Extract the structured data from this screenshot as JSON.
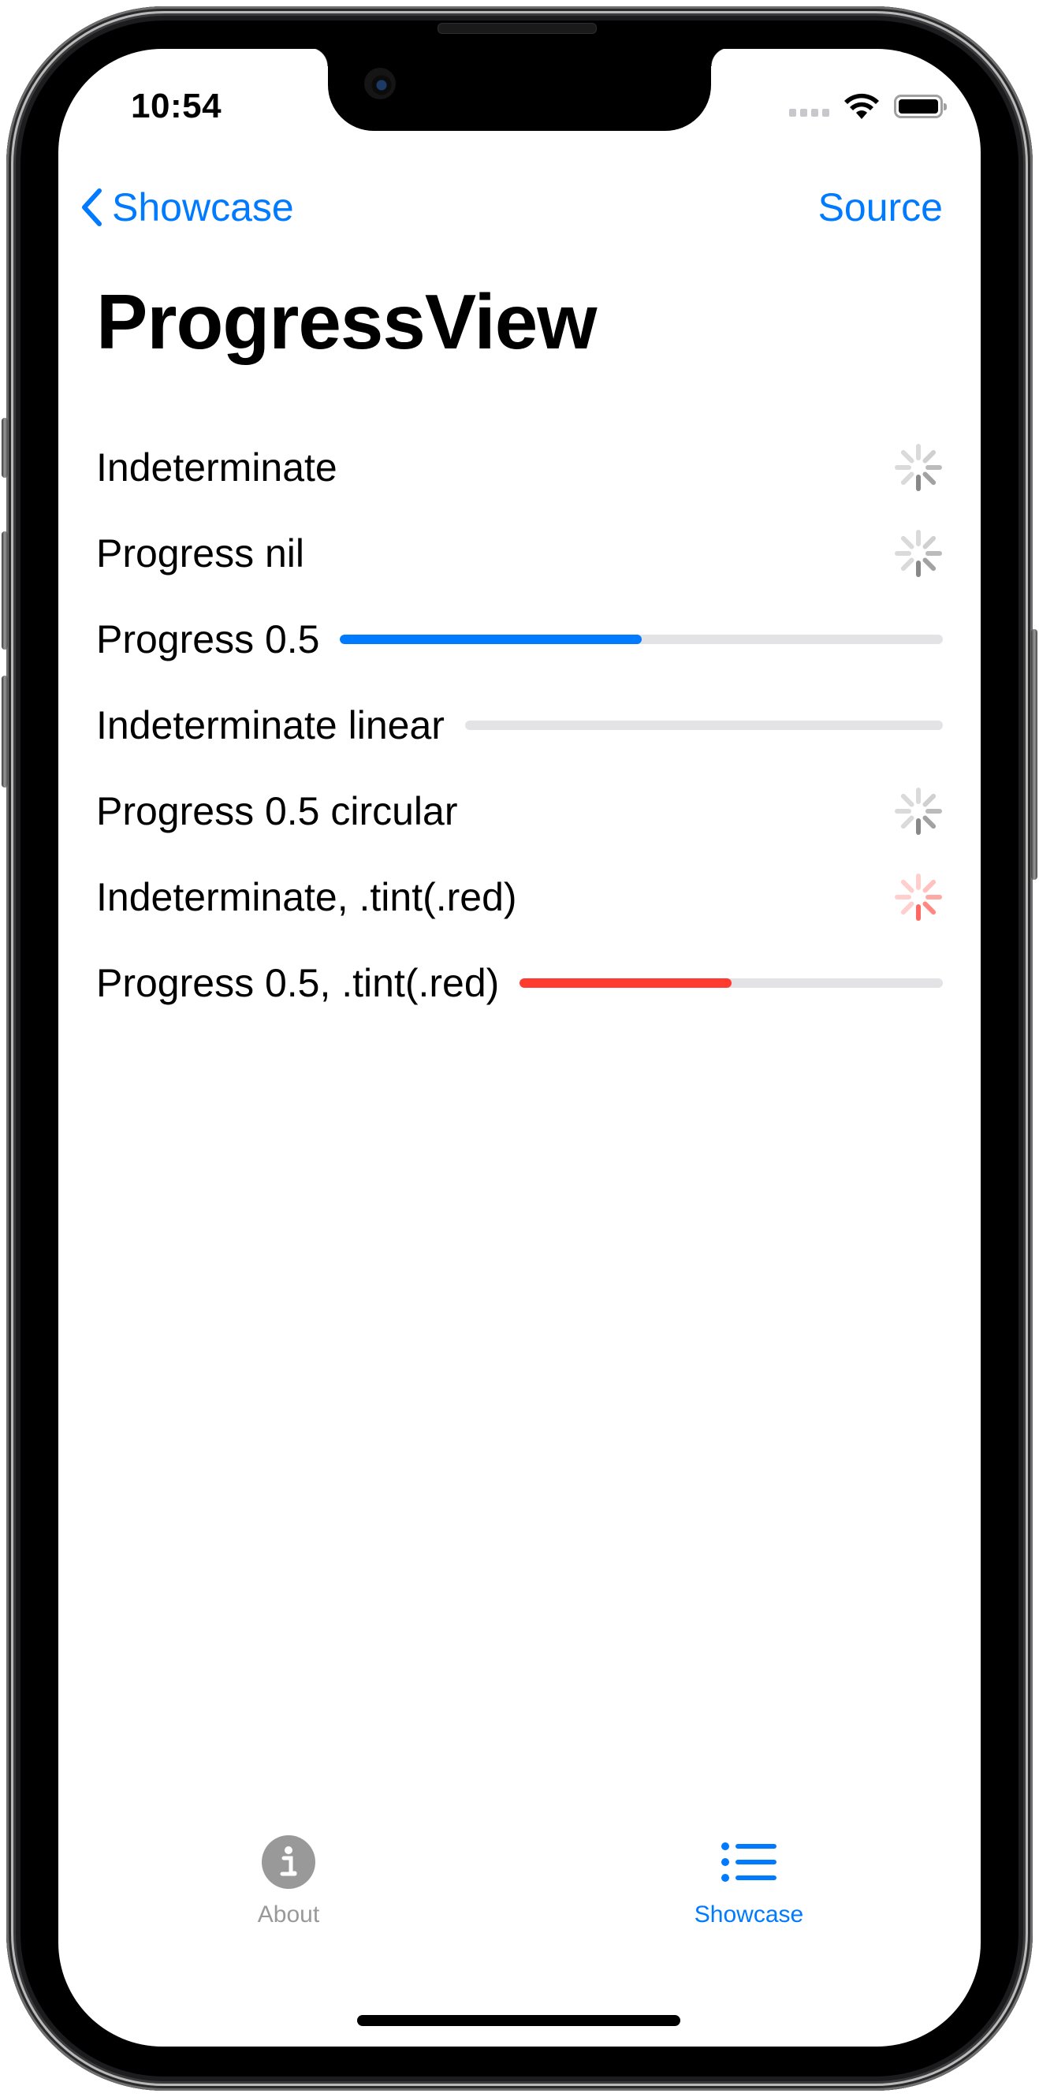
{
  "status_bar": {
    "time": "10:54",
    "icons": [
      "cellular-signal-icon",
      "wifi-icon",
      "battery-icon"
    ]
  },
  "nav": {
    "back_label": "Showcase",
    "back_icon": "chevron-left-icon",
    "action_label": "Source"
  },
  "page": {
    "title": "ProgressView"
  },
  "colors": {
    "accent": "#007aff",
    "red": "#ff3b30",
    "track": "#e3e3e5",
    "tab_inactive": "#999999"
  },
  "rows": [
    {
      "label": "Indeterminate",
      "kind": "spinner",
      "tint": "gray"
    },
    {
      "label": "Progress nil",
      "kind": "spinner",
      "tint": "gray"
    },
    {
      "label": "Progress 0.5",
      "kind": "linear",
      "progress": 0.5,
      "tint": "#007aff"
    },
    {
      "label": "Indeterminate linear",
      "kind": "linear",
      "progress": 0,
      "tint": "#007aff"
    },
    {
      "label": "Progress 0.5 circular",
      "kind": "spinner",
      "tint": "gray"
    },
    {
      "label": "Indeterminate, .tint(.red)",
      "kind": "spinner",
      "tint": "red"
    },
    {
      "label": "Progress 0.5, .tint(.red)",
      "kind": "linear",
      "progress": 0.5,
      "tint": "#ff3b30"
    }
  ],
  "tabs": [
    {
      "label": "About",
      "icon": "info-circle-icon",
      "selected": false
    },
    {
      "label": "Showcase",
      "icon": "list-bullet-icon",
      "selected": true
    }
  ]
}
